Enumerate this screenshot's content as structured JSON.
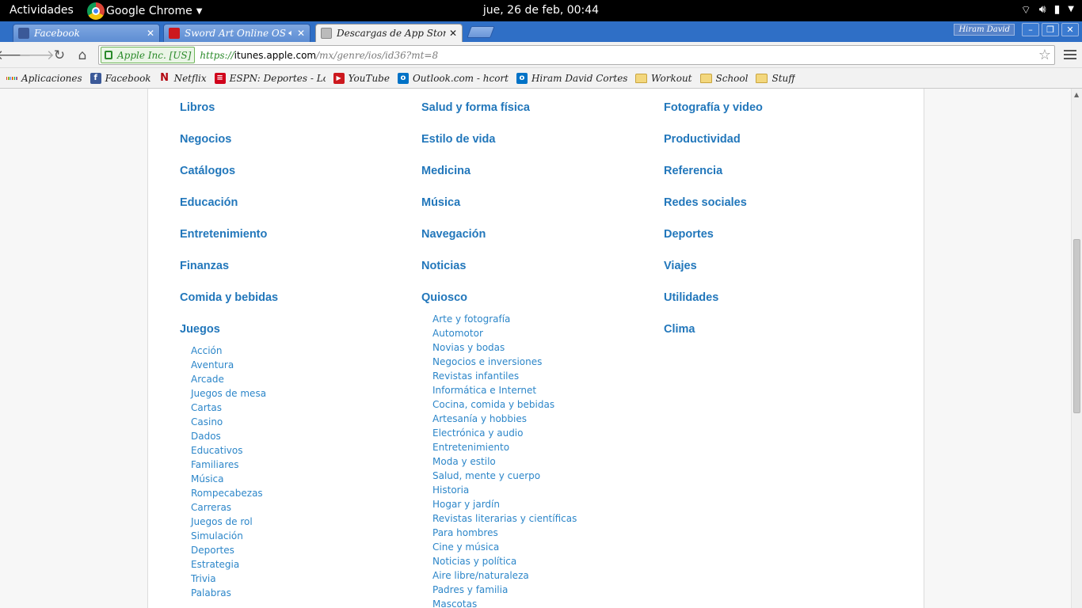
{
  "system_bar": {
    "activities": "Actividades",
    "app_name": "Google Chrome",
    "clock": "jue, 26 de feb, 00:44"
  },
  "tabs": [
    {
      "title": "Facebook",
      "favicon": "facebook-icon"
    },
    {
      "title": "Sword Art Online OS",
      "favicon": "youtube-icon",
      "audio": true
    },
    {
      "title": "Descargas de App Store e",
      "favicon": "apple-page-icon",
      "active": true
    }
  ],
  "window": {
    "user": "Hiram David"
  },
  "toolbar": {
    "ev_label": "Apple Inc. [US]",
    "url_scheme": "https://",
    "url_host": "itunes.apple.com",
    "url_path": "/mx/genre/ios/id36?mt=8"
  },
  "bookmarks": [
    {
      "label": "Aplicaciones",
      "icon": "apps-grid-icon"
    },
    {
      "label": "Facebook",
      "icon": "facebook-icon"
    },
    {
      "label": "Netflix",
      "icon": "netflix-icon"
    },
    {
      "label": "ESPN: Deportes - Lo",
      "icon": "espn-icon"
    },
    {
      "label": "YouTube",
      "icon": "youtube-icon"
    },
    {
      "label": "Outlook.com - hcortes",
      "icon": "outlook-icon"
    },
    {
      "label": "Hiram David Cortes",
      "icon": "outlook-icon"
    },
    {
      "label": "Workout",
      "icon": "folder-icon"
    },
    {
      "label": "School",
      "icon": "folder-icon"
    },
    {
      "label": "Stuff",
      "icon": "folder-icon"
    }
  ],
  "columns": [
    [
      {
        "name": "Libros"
      },
      {
        "name": "Negocios"
      },
      {
        "name": "Catálogos"
      },
      {
        "name": "Educación"
      },
      {
        "name": "Entretenimiento"
      },
      {
        "name": "Finanzas"
      },
      {
        "name": "Comida y bebidas"
      },
      {
        "name": "Juegos",
        "sub": [
          "Acción",
          "Aventura",
          "Arcade",
          "Juegos de mesa",
          "Cartas",
          "Casino",
          "Dados",
          "Educativos",
          "Familiares",
          "Música",
          "Rompecabezas",
          "Carreras",
          "Juegos de rol",
          "Simulación",
          "Deportes",
          "Estrategia",
          "Trivia",
          "Palabras"
        ]
      }
    ],
    [
      {
        "name": "Salud y forma física"
      },
      {
        "name": "Estilo de vida"
      },
      {
        "name": "Medicina"
      },
      {
        "name": "Música"
      },
      {
        "name": "Navegación"
      },
      {
        "name": "Noticias"
      },
      {
        "name": "Quiosco",
        "sub": [
          "Arte y fotografía",
          "Automotor",
          "Novias y bodas",
          "Negocios e inversiones",
          "Revistas infantiles",
          "Informática e Internet",
          "Cocina, comida y bebidas",
          "Artesanía y hobbies",
          "Electrónica y audio",
          "Entretenimiento",
          "Moda y estilo",
          "Salud, mente y cuerpo",
          "Historia",
          "Hogar y jardín",
          "Revistas literarias y científicas",
          "Para hombres",
          "Cine y música",
          "Noticias y política",
          "Aire libre/naturaleza",
          "Padres y familia",
          "Mascotas"
        ]
      }
    ],
    [
      {
        "name": "Fotografía y video"
      },
      {
        "name": "Productividad"
      },
      {
        "name": "Referencia"
      },
      {
        "name": "Redes sociales"
      },
      {
        "name": "Deportes"
      },
      {
        "name": "Viajes"
      },
      {
        "name": "Utilidades"
      },
      {
        "name": "Clima"
      }
    ]
  ],
  "colors": {
    "link": "#2277bb",
    "tab_strip": "#2f6fc6"
  }
}
